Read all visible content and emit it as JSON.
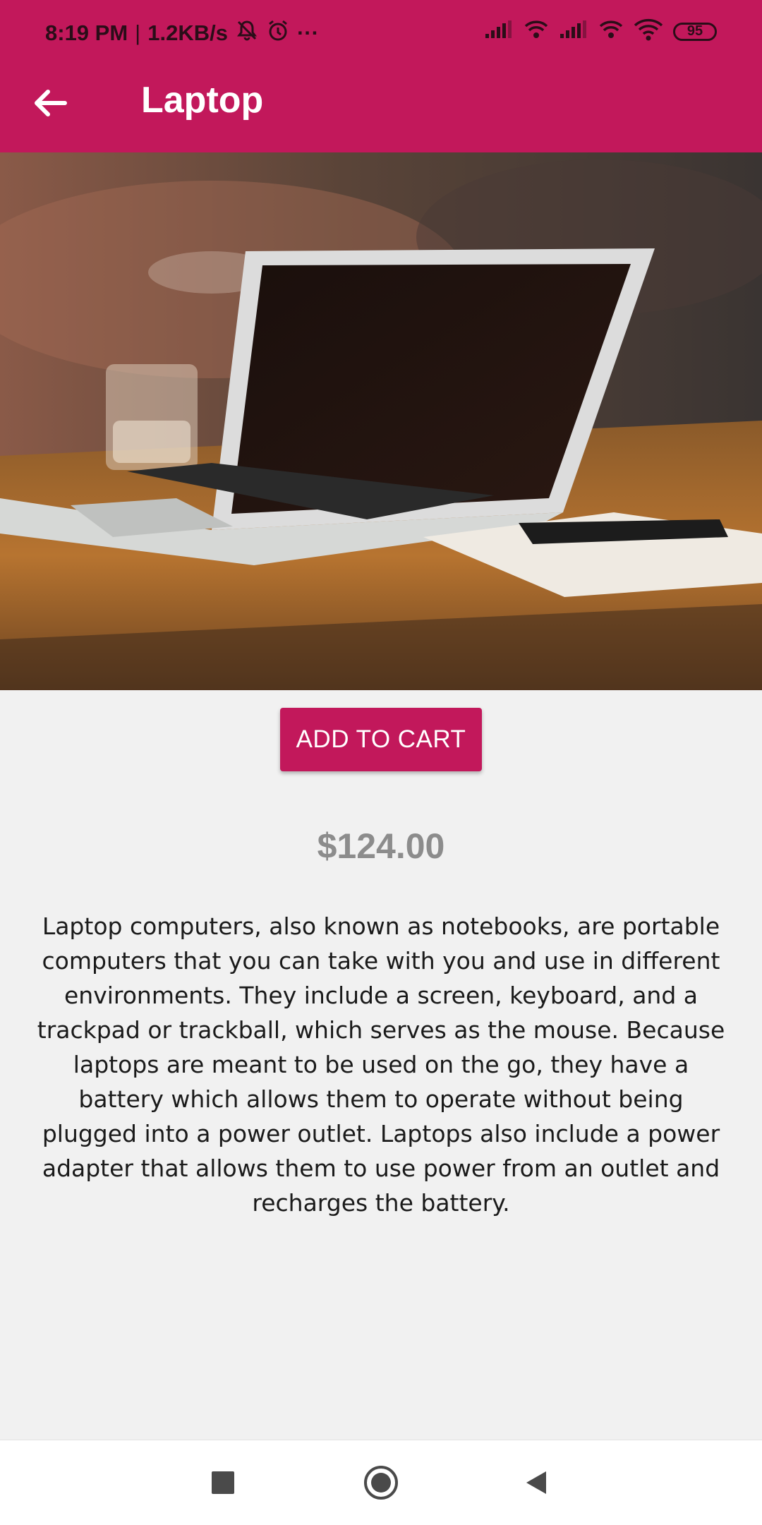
{
  "status_bar": {
    "time": "8:19 PM",
    "separator": "|",
    "speed": "1.2KB/s",
    "more": "···",
    "battery": "95",
    "icons": [
      "muted-bell-icon",
      "alarm-icon",
      "signal-icon",
      "wifi-icon",
      "signal-icon",
      "wifi-icon",
      "wifi-icon",
      "battery-icon"
    ]
  },
  "app_bar": {
    "title": "Laptop",
    "back_icon": "arrow-left-icon",
    "color": "#c2185b"
  },
  "product": {
    "image_alt_subject": "laptop-on-wooden-table-photo",
    "add_to_cart_label": "ADD TO CART",
    "price": "$124.00",
    "description": "Laptop computers, also known as notebooks, are portable computers that you can take with you and use in different environments. They include a screen, keyboard, and a trackpad or trackball, which serves as the mouse. Because laptops are meant to be used on the go, they have a battery which allows them to operate without being plugged into a power outlet. Laptops also include a power adapter that allows them to use power from an outlet and recharges the battery."
  },
  "nav_bar": {
    "icons": [
      "square-recents-icon",
      "circle-home-icon",
      "triangle-back-icon"
    ]
  }
}
